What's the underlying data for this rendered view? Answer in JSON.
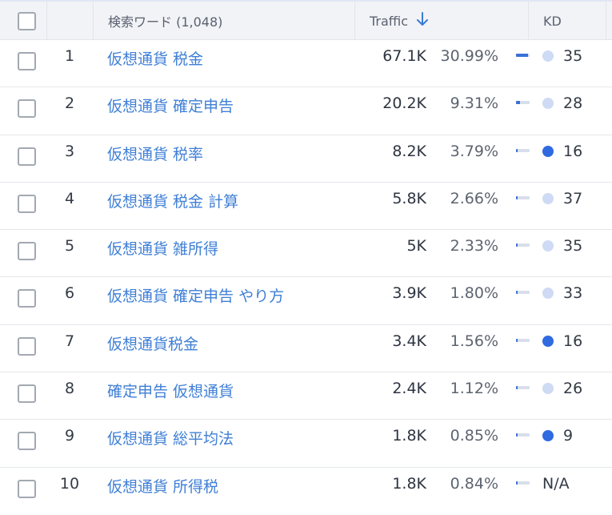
{
  "header": {
    "keyword_col_label": "検索ワード (1,048)",
    "traffic_col_label": "Traffic",
    "traffic_sort_icon": "arrow-down-icon",
    "kd_col_label": "KD"
  },
  "colors": {
    "link": "#3f7fd6",
    "kd_easy": "#cfdaf4",
    "kd_hard": "#2f6ae0",
    "bar": "#3a6fd8"
  },
  "rows": [
    {
      "num": "1",
      "keyword": "仮想通貨 税金",
      "traffic": "67.1K",
      "pct": "30.99%",
      "share": 0.3099,
      "kd": "35",
      "kd_level": "easy"
    },
    {
      "num": "2",
      "keyword": "仮想通貨 確定申告",
      "traffic": "20.2K",
      "pct": "9.31%",
      "share": 0.0931,
      "kd": "28",
      "kd_level": "easy"
    },
    {
      "num": "3",
      "keyword": "仮想通貨 税率",
      "traffic": "8.2K",
      "pct": "3.79%",
      "share": 0.0379,
      "kd": "16",
      "kd_level": "hard"
    },
    {
      "num": "4",
      "keyword": "仮想通貨 税金 計算",
      "traffic": "5.8K",
      "pct": "2.66%",
      "share": 0.0266,
      "kd": "37",
      "kd_level": "easy"
    },
    {
      "num": "5",
      "keyword": "仮想通貨 雑所得",
      "traffic": "5K",
      "pct": "2.33%",
      "share": 0.0233,
      "kd": "35",
      "kd_level": "easy"
    },
    {
      "num": "6",
      "keyword": "仮想通貨 確定申告 やり方",
      "traffic": "3.9K",
      "pct": "1.80%",
      "share": 0.018,
      "kd": "33",
      "kd_level": "easy"
    },
    {
      "num": "7",
      "keyword": "仮想通貨税金",
      "traffic": "3.4K",
      "pct": "1.56%",
      "share": 0.0156,
      "kd": "16",
      "kd_level": "hard"
    },
    {
      "num": "8",
      "keyword": "確定申告 仮想通貨",
      "traffic": "2.4K",
      "pct": "1.12%",
      "share": 0.0112,
      "kd": "26",
      "kd_level": "easy"
    },
    {
      "num": "9",
      "keyword": "仮想通貨 総平均法",
      "traffic": "1.8K",
      "pct": "0.85%",
      "share": 0.0085,
      "kd": "9",
      "kd_level": "hard"
    },
    {
      "num": "10",
      "keyword": "仮想通貨 所得税",
      "traffic": "1.8K",
      "pct": "0.84%",
      "share": 0.0084,
      "kd": "N/A",
      "kd_level": "none"
    }
  ]
}
